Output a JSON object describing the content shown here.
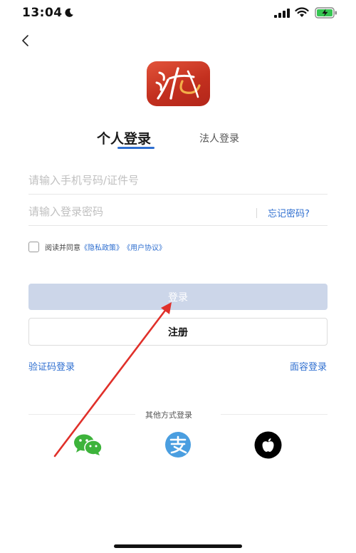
{
  "status_bar": {
    "time": "13:04",
    "icons": [
      "moon-icon",
      "signal-icon",
      "wifi-icon",
      "battery-charging-icon"
    ]
  },
  "nav": {
    "back_icon": "chevron-left-icon"
  },
  "logo": {
    "icon": "app-logo",
    "colors": [
      "#e2533a",
      "#b3261a",
      "#ffffff",
      "#f2b04a"
    ]
  },
  "tabs": [
    {
      "label": "个人登录",
      "active": true
    },
    {
      "label": "法人登录",
      "active": false
    }
  ],
  "form": {
    "account_placeholder": "请输入手机号码/证件号",
    "account_value": "",
    "password_placeholder": "请输入登录密码",
    "password_value": "",
    "forgot_label": "忘记密码?"
  },
  "agreement": {
    "checked": false,
    "prefix": "阅读并同意",
    "privacy_link": "《隐私政策》",
    "user_link": "《用户协议》"
  },
  "buttons": {
    "login": "登录",
    "register": "注册",
    "code_login": "验证码登录",
    "face_login": "面容登录"
  },
  "other_login": {
    "title": "其他方式登录",
    "methods": [
      {
        "icon": "wechat-icon",
        "color": "#3db33b"
      },
      {
        "icon": "alipay-icon",
        "color": "#4a9ee0"
      },
      {
        "icon": "apple-icon",
        "color": "#000000"
      }
    ]
  },
  "theme": {
    "accent": "#2f6fd0",
    "login_disabled_bg": "#ccd6e9",
    "annotation_arrow": "#e0302a"
  }
}
